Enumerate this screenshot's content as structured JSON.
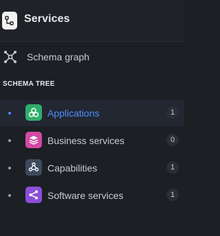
{
  "header": {
    "title": "Services",
    "icon": "hierarchy-icon"
  },
  "nav": {
    "schema_graph": {
      "label": "Schema graph",
      "icon": "graph-icon"
    }
  },
  "section": {
    "title": "SCHEMA TREE"
  },
  "tree": [
    {
      "label": "Applications",
      "count": "1",
      "icon": "applications-icon",
      "color": "#2fae6b",
      "active": true
    },
    {
      "label": "Business services",
      "count": "0",
      "icon": "business-services-icon",
      "color": "#d24aa3",
      "active": false
    },
    {
      "label": "Capabilities",
      "count": "1",
      "icon": "capabilities-icon",
      "color": "#3d4a5e",
      "active": false
    },
    {
      "label": "Software services",
      "count": "1",
      "icon": "software-services-icon",
      "color": "#8b4fd9",
      "active": false
    }
  ],
  "colors": {
    "background": "#1c1f24",
    "accent": "#4f8fff",
    "active_row": "#222731"
  }
}
